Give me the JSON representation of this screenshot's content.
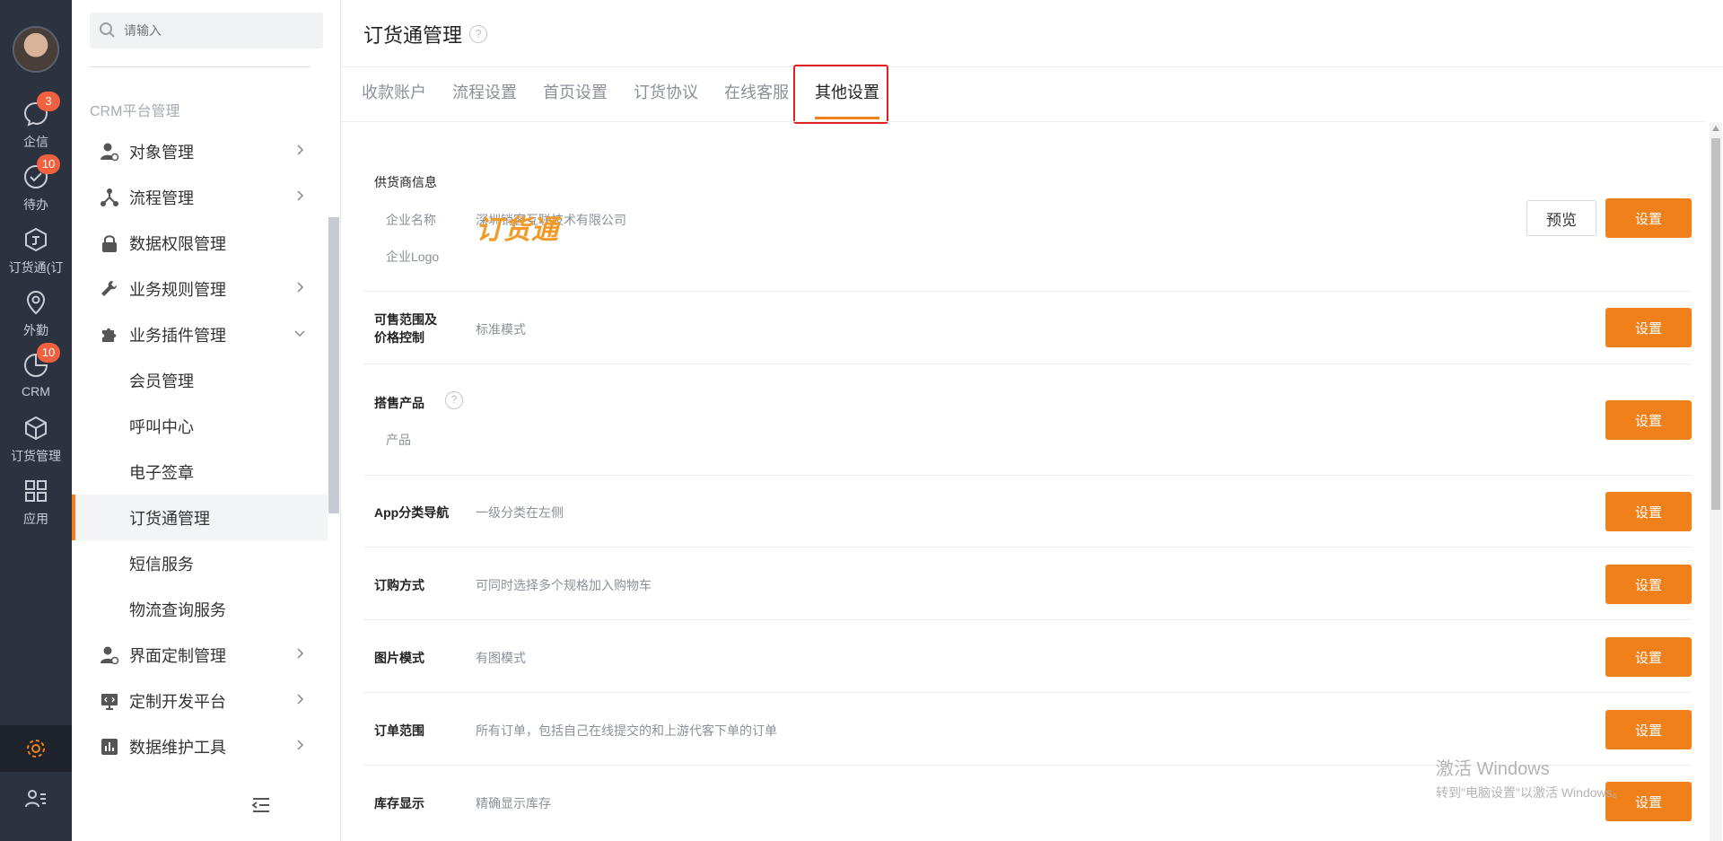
{
  "rail": {
    "items": [
      {
        "label": "企信",
        "badge": "3"
      },
      {
        "label": "待办",
        "badge": "10"
      },
      {
        "label": "订货通(订",
        "badge": ""
      },
      {
        "label": "外勤",
        "badge": ""
      },
      {
        "label": "CRM",
        "badge": "10"
      },
      {
        "label": "订货管理",
        "badge": ""
      },
      {
        "label": "应用",
        "badge": ""
      }
    ]
  },
  "nav": {
    "search_placeholder": "请输入",
    "section_title": "CRM平台管理",
    "items": [
      {
        "label": "对象管理"
      },
      {
        "label": "流程管理"
      },
      {
        "label": "数据权限管理"
      },
      {
        "label": "业务规则管理"
      },
      {
        "label": "业务插件管理"
      },
      {
        "label": "会员管理"
      },
      {
        "label": "呼叫中心"
      },
      {
        "label": "电子签章"
      },
      {
        "label": "订货通管理"
      },
      {
        "label": "短信服务"
      },
      {
        "label": "物流查询服务"
      },
      {
        "label": "界面定制管理"
      },
      {
        "label": "定制开发平台"
      },
      {
        "label": "数据维护工具"
      }
    ]
  },
  "main": {
    "title": "订货通管理",
    "help": "?",
    "tabs": [
      {
        "label": "收款账户"
      },
      {
        "label": "流程设置"
      },
      {
        "label": "首页设置"
      },
      {
        "label": "订货协议"
      },
      {
        "label": "在线客服"
      },
      {
        "label": "其他设置"
      }
    ],
    "preview_label": "预览",
    "set_label": "设置",
    "sections": {
      "supplier": {
        "title": "供货商信息",
        "company_label": "企业名称",
        "company_value": "深圳销客互联技术有限公司",
        "logo_label": "企业Logo",
        "logo_text": "订货通"
      },
      "scope": {
        "label1": "可售范围及",
        "label2": "价格控制",
        "value": "标准模式"
      },
      "onsale": {
        "label": "搭售产品",
        "sub_label": "产品"
      },
      "appnav": {
        "label": "App分类导航",
        "value": "一级分类在左侧"
      },
      "order_mode": {
        "label": "订购方式",
        "value": "可同时选择多个规格加入购物车"
      },
      "image_mode": {
        "label": "图片模式",
        "value": "有图模式"
      },
      "order_scope": {
        "label": "订单范围",
        "value": "所有订单，包括自己在线提交的和上游代客下单的订单"
      },
      "stock": {
        "label": "库存显示",
        "value": "精确显示库存"
      }
    }
  },
  "watermark": {
    "line1": "激活 Windows",
    "line2": "转到\"电脑设置\"以激活 Windows。"
  }
}
